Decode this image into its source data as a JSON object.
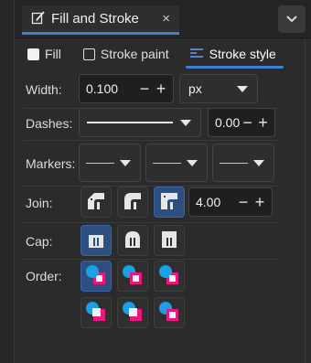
{
  "panel_tab": {
    "title": "Fill and Stroke",
    "close_symbol": "×"
  },
  "subtabs": [
    {
      "label": "Fill",
      "icon": "checkbox-filled"
    },
    {
      "label": "Stroke paint",
      "icon": "checkbox-empty"
    },
    {
      "label": "Stroke style",
      "icon": "stroke-style-icon",
      "active": true
    }
  ],
  "width": {
    "label": "Width:",
    "value": "0.100",
    "unit": "px",
    "minus": "−",
    "plus": "+"
  },
  "dashes": {
    "label": "Dashes:",
    "offset": "0.00",
    "minus": "−",
    "plus": "+"
  },
  "markers": {
    "label": "Markers:"
  },
  "join": {
    "label": "Join:",
    "miter_limit": "4.00",
    "minus": "−",
    "plus": "+",
    "selected": "miter"
  },
  "cap": {
    "label": "Cap:",
    "selected": "butt"
  },
  "order": {
    "label": "Order:",
    "selected": 0
  },
  "colors": {
    "accent": "#3f7fd6",
    "active_button": "#2d4f80",
    "order_fill": "#e8197d",
    "order_stroke": "#19a0e6"
  }
}
